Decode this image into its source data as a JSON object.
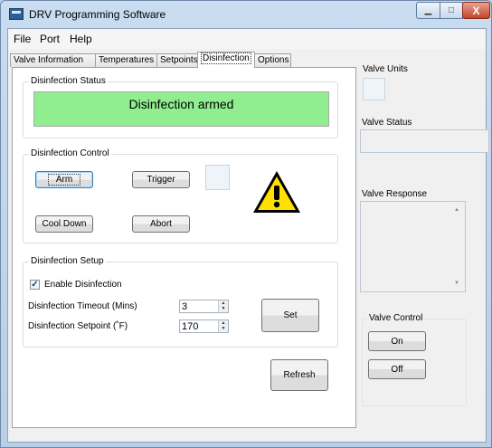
{
  "window": {
    "title": "DRV Programming Software",
    "minimize": "▁",
    "maximize": "□",
    "close": "X"
  },
  "menu": [
    "File",
    "Port",
    "Help"
  ],
  "tabs": [
    {
      "label": "Valve Information",
      "active": false
    },
    {
      "label": "Temperatures",
      "active": false
    },
    {
      "label": "Setpoints",
      "active": false
    },
    {
      "label": "Disinfection",
      "active": true
    },
    {
      "label": "Options",
      "active": false
    }
  ],
  "disinfection_status": {
    "group_label": "Disinfection Status",
    "status_text": "Disinfection armed",
    "status_color": "#90ee90"
  },
  "disinfection_control": {
    "group_label": "Disinfection Control",
    "arm_label": "Arm",
    "trigger_label": "Trigger",
    "cool_down_label": "Cool Down",
    "abort_label": "Abort",
    "warning_icon": "warning-triangle-icon"
  },
  "disinfection_setup": {
    "group_label": "Disinfection Setup",
    "enable_label": "Enable Disinfection",
    "enable_checked": true,
    "timeout_label": "Disinfection Timeout (Mins)",
    "timeout_value": "3",
    "setpoint_label": "Disinfection Setpoint (˚F)",
    "setpoint_value": "170",
    "set_label": "Set"
  },
  "refresh_label": "Refresh",
  "right_panel": {
    "valve_units_label": "Valve Units",
    "valve_status_label": "Valve Status",
    "valve_response_label": "Valve Response",
    "valve_control_label": "Valve Control",
    "on_label": "On",
    "off_label": "Off"
  }
}
